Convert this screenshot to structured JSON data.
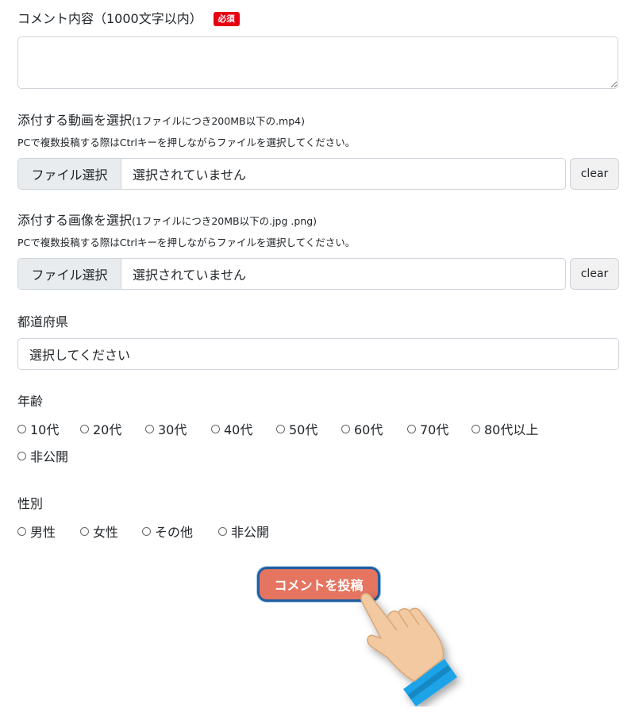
{
  "comment": {
    "label": "コメント内容（1000文字以内）",
    "required_badge": "必須",
    "value": ""
  },
  "video": {
    "label_main": "添付する動画を選択",
    "label_small": "(1ファイルにつき200MB以下の.mp4)",
    "note": "PCで複数投稿する際はCtrlキーを押しながらファイルを選択してください。",
    "button": "ファイル選択",
    "status": "選択されていません",
    "clear": "clear"
  },
  "image": {
    "label_main": "添付する画像を選択",
    "label_small": "(1ファイルにつき20MB以下の.jpg .png)",
    "note": "PCで複数投稿する際はCtrlキーを押しながらファイルを選択してください。",
    "button": "ファイル選択",
    "status": "選択されていません",
    "clear": "clear"
  },
  "prefecture": {
    "label": "都道府県",
    "selected": "選択してください"
  },
  "age": {
    "label": "年齢",
    "options": [
      "10代",
      "20代",
      "30代",
      "40代",
      "50代",
      "60代",
      "70代",
      "80代以上",
      "非公開"
    ]
  },
  "gender": {
    "label": "性別",
    "options": [
      "男性",
      "女性",
      "その他",
      "非公開"
    ]
  },
  "submit": {
    "label": "コメントを投稿"
  },
  "icons": {
    "pointer": "pointing-hand-icon"
  },
  "colors": {
    "required": "#e60012",
    "submit_bg": "#e57560",
    "submit_border": "#1f5fa0"
  }
}
